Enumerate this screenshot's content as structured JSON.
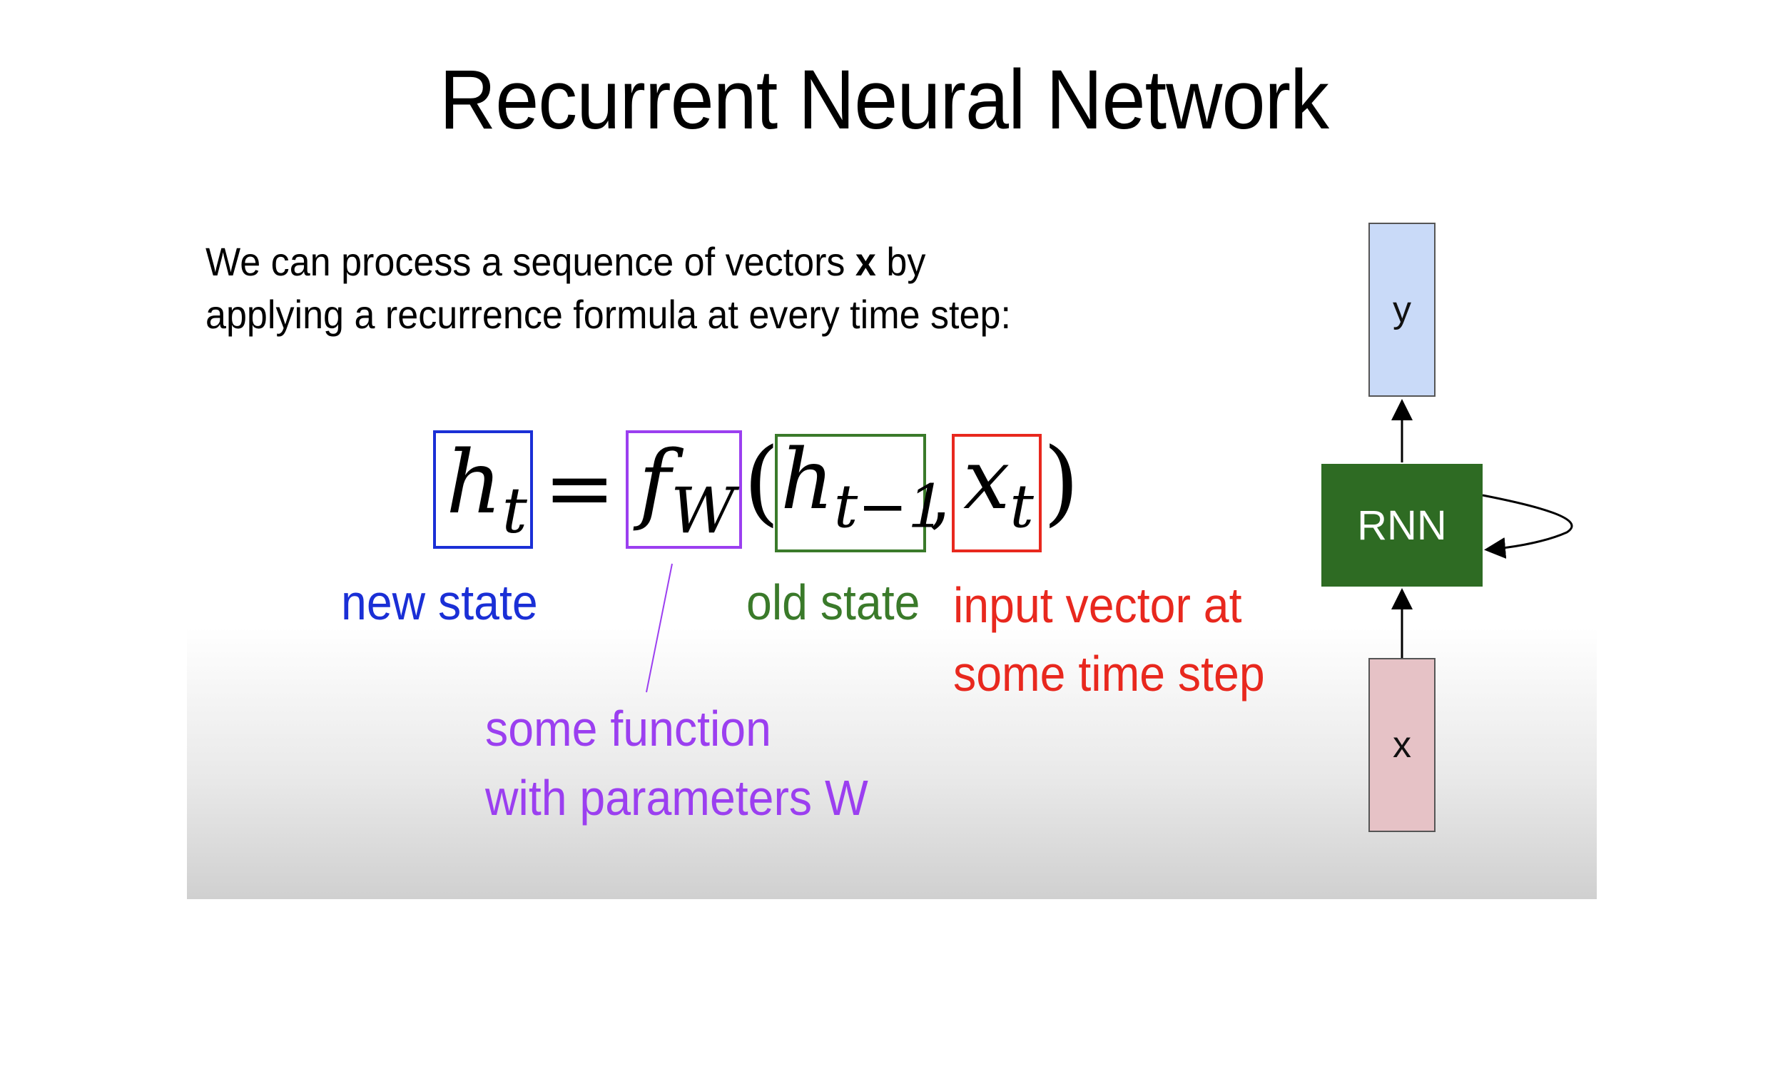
{
  "slide": {
    "title": "Recurrent Neural Network",
    "intro": {
      "line1_before": "We can process a sequence of vectors ",
      "line1_bold": "x",
      "line1_after": " by",
      "line2": "applying a recurrence formula at every time step:"
    }
  },
  "equation": {
    "lhs": "h",
    "lhs_sub": "t",
    "equals": "=",
    "func": "f",
    "func_sub": "W",
    "open_paren": "(",
    "old": "h",
    "old_sub": "t−1",
    "comma": ",",
    "input": "x",
    "input_sub": "t",
    "close_paren": ")"
  },
  "labels": {
    "new_state": "new state",
    "old_state": "old state",
    "input_vector_line1": "input vector at",
    "input_vector_line2": "some time step",
    "function_line1": "some function",
    "function_line2": "with parameters W"
  },
  "diagram": {
    "output": "y",
    "cell": "RNN",
    "input": "x"
  },
  "colors": {
    "new_state": "#1a2fd6",
    "function": "#9b3ff0",
    "old_state": "#3a7a2a",
    "input": "#e8281e",
    "rnn_fill": "#2e6b23",
    "y_fill": "#c9daf8",
    "x_fill": "#e6c2c6"
  }
}
